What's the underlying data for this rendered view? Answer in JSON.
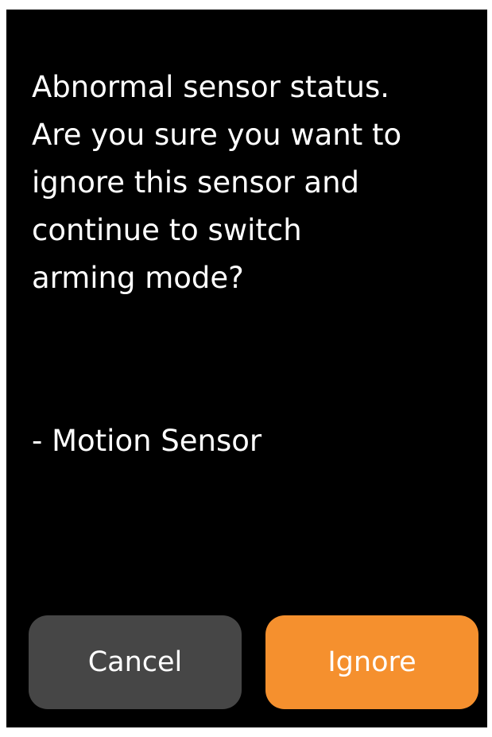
{
  "dialog": {
    "message": "Abnormal sensor status.\nAre you sure you want to\nignore this sensor and\ncontinue to switch\narming mode?",
    "sensor_item": "- Motion Sensor",
    "cancel_label": "Cancel",
    "ignore_label": "Ignore"
  },
  "colors": {
    "background": "#000000",
    "cancel_button": "#464646",
    "ignore_button": "#f5902e",
    "text": "#ffffff"
  }
}
